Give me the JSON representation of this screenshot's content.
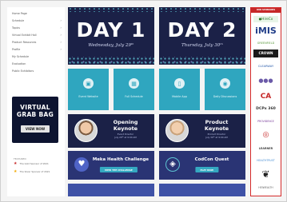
{
  "sidebar": {
    "items": [
      {
        "label": "Home Page",
        "chevron": false
      },
      {
        "label": "Schedule",
        "chevron": true
      },
      {
        "label": "Topics",
        "chevron": true
      },
      {
        "label": "Virtual Exhibit Hall",
        "chevron": true
      },
      {
        "label": "Product Resources",
        "chevron": true
      },
      {
        "label": "Profile",
        "chevron": true
      },
      {
        "label": "My Schedule",
        "chevron": false
      },
      {
        "label": "Evaluation",
        "chevron": false
      },
      {
        "label": "Public Exhibitors",
        "chevron": false
      }
    ],
    "grab_bag": {
      "line1": "VIRTUAL",
      "line2": "GRAB BAG",
      "button": "VIEW NOW"
    },
    "featured_label": "FEATURED",
    "featured": [
      {
        "text": "The Gold Sponsor of 2021",
        "star_color": "#c62828"
      },
      {
        "text": "The Silver Sponsor of 2021",
        "star_color": "#f2a900"
      }
    ]
  },
  "main": {
    "days": [
      {
        "title": "DAY 1",
        "date": "Wednesday, July 29ᵗʰ"
      },
      {
        "title": "DAY 2",
        "date": "Thursday, July 30ᵗʰ"
      }
    ],
    "tiles": [
      {
        "label": "Event Website",
        "icon": "monitor-icon",
        "glyph": "▣"
      },
      {
        "label": "Full Schedule",
        "icon": "calendar-icon",
        "glyph": "▦"
      },
      {
        "label": "Mobile App",
        "icon": "phone-icon",
        "glyph": "▯"
      },
      {
        "label": "Daily Discussions",
        "icon": "chat-icon",
        "glyph": "◉"
      }
    ],
    "keynotes": [
      {
        "title_line1": "Opening",
        "title_line2": "Keynote",
        "detail_line1": "Event Director",
        "detail_line2": "July 29ᵗʰ at 9:00 AM"
      },
      {
        "title_line1": "Product",
        "title_line2": "Keynote",
        "detail_line1": "Product Director",
        "detail_line2": "July 30ᵗʰ at 9:00 AM"
      }
    ],
    "promos": [
      {
        "title": "Meka Health Challenge",
        "button": "VIEW THE CHALLENGE",
        "icon": "heart-icon",
        "glyph": "♥"
      },
      {
        "title": "CodCon Quest",
        "button": "PLAY NOW",
        "icon": "compass-icon",
        "glyph": "◈"
      }
    ]
  },
  "sponsors": {
    "header": "OUR SPONSORS",
    "logos": [
      {
        "text": "●HireCo",
        "color": "#2b7a2b"
      },
      {
        "text": "iMIS",
        "color": "#1f3c88"
      },
      {
        "text": "GREENFIELD",
        "color": "#5a9a3c"
      },
      {
        "text": "CROWN",
        "color": "#ffffff"
      },
      {
        "text": "CLEARWAY",
        "color": "#2a5caa"
      },
      {
        "text": "●●●",
        "color": "#6b5aa8"
      },
      {
        "text": "CA",
        "color": "#c62828"
      },
      {
        "text": "DCPx 360",
        "color": "#333333"
      },
      {
        "text": "PROVIDENCE",
        "color": "#7a3c9a"
      },
      {
        "text": "◎",
        "color": "#c62828"
      },
      {
        "text": "LEARNER",
        "color": "#444444"
      },
      {
        "text": "HEALTHTRUST",
        "color": "#4a8fd4"
      },
      {
        "text": "❦",
        "color": "#222222"
      },
      {
        "text": "HEIWEALTH",
        "color": "#666666"
      }
    ]
  }
}
